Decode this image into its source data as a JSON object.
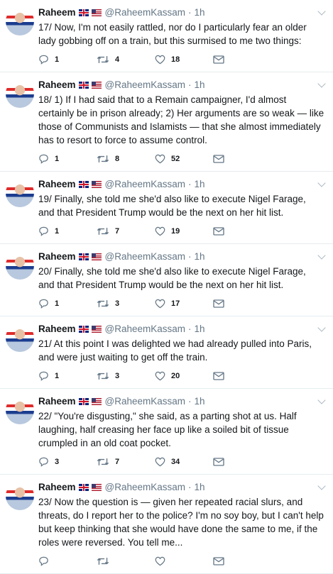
{
  "tweets": [
    {
      "name": "Raheem",
      "handle": "@RaheemKassam",
      "time": "1h",
      "text": "17/ Now, I'm not easily rattled, nor do I particularly fear an older lady gobbing off on a train, but this surmised to me two things:",
      "replies": "1",
      "retweets": "4",
      "likes": "18"
    },
    {
      "name": "Raheem",
      "handle": "@RaheemKassam",
      "time": "1h",
      "text": "18/ 1) If I had said that to a Remain campaigner, I'd almost certainly be in prison already; 2) Her arguments are so weak — like those of Communists and Islamists — that she almost immediately has to resort to force to assume control.",
      "replies": "1",
      "retweets": "8",
      "likes": "52"
    },
    {
      "name": "Raheem",
      "handle": "@RaheemKassam",
      "time": "1h",
      "text": "19/ Finally, she told me she'd also like to execute Nigel Farage, and that President Trump would be the next on her hit list.",
      "replies": "1",
      "retweets": "7",
      "likes": "19"
    },
    {
      "name": "Raheem",
      "handle": "@RaheemKassam",
      "time": "1h",
      "text": "20/ Finally, she told me she'd also like to execute Nigel Farage, and that President Trump would be the next on her hit list.",
      "replies": "1",
      "retweets": "3",
      "likes": "17"
    },
    {
      "name": "Raheem",
      "handle": "@RaheemKassam",
      "time": "1h",
      "text": "21/ At this point I was delighted we had already pulled into Paris, and were just waiting to get off the train.",
      "replies": "1",
      "retweets": "3",
      "likes": "20"
    },
    {
      "name": "Raheem",
      "handle": "@RaheemKassam",
      "time": "1h",
      "text": "22/ \"You're disgusting,\" she said, as a parting shot at us. Half laughing, half creasing her face up like a soiled bit of tissue crumpled in an old coat pocket.",
      "replies": "3",
      "retweets": "7",
      "likes": "34"
    },
    {
      "name": "Raheem",
      "handle": "@RaheemKassam",
      "time": "1h",
      "text": "23/ Now the question is — given her repeated racial slurs, and threats, do I report her to the police? I'm no soy boy, but I can't help but keep thinking that she would have done the same to me, if the roles were reversed. You tell me...",
      "replies": "",
      "retweets": "",
      "likes": ""
    }
  ],
  "colors": {
    "text": "#14171a",
    "muted": "#657786",
    "icon": "#657786",
    "divider": "#e6ecf0"
  },
  "icons": {
    "reply": "reply-icon",
    "retweet": "retweet-icon",
    "like": "heart-icon",
    "dm": "envelope-icon",
    "menu": "chevron-down-icon"
  }
}
